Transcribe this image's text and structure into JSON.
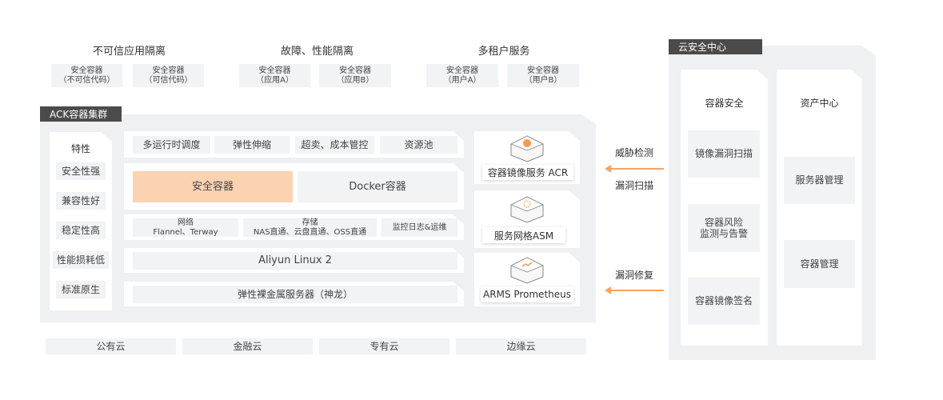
{
  "top_cards": [
    {
      "title": "不可信应用隔离",
      "items": [
        [
          "安全容器",
          "（不可信代码）"
        ],
        [
          "安全容器",
          "（可信代码）"
        ]
      ]
    },
    {
      "title": "故障、性能隔离",
      "items": [
        [
          "安全容器",
          "（应用A）"
        ],
        [
          "安全容器",
          "（应用B）"
        ]
      ]
    },
    {
      "title": "多租户服务",
      "items": [
        [
          "安全容器",
          "（用户A）"
        ],
        [
          "安全容器",
          "（用户B）"
        ]
      ]
    }
  ],
  "ack": {
    "label": "ACK容器集群",
    "features": {
      "title": "特性",
      "items": [
        "安全性强",
        "兼容性好",
        "稳定性高",
        "性能损耗低",
        "标准原生"
      ]
    },
    "row1": [
      "多运行时调度",
      "弹性伸缩",
      "超卖、成本管控",
      "资源池"
    ],
    "row2": {
      "secure": "安全容器",
      "docker": "Docker容器",
      "highlight_color": "#fbd3b1"
    },
    "row3": [
      [
        "网络",
        "Flannel、Terway"
      ],
      [
        "存储",
        "NAS直通、云盘直通、OSS直通"
      ],
      [
        "监控日志&运维"
      ]
    ],
    "os": "Aliyun Linux 2",
    "hardware": "弹性裸金属服务器（神龙）",
    "services": [
      {
        "name": "容器镜像服务 ACR",
        "icon": "registry-cube-icon"
      },
      {
        "name": "服务网格ASM",
        "icon": "mesh-cube-icon"
      },
      {
        "name": "ARMS Prometheus",
        "icon": "monitor-cube-icon"
      }
    ]
  },
  "arrows": {
    "top": [
      "威胁检测",
      "漏洞扫描"
    ],
    "bottom": [
      "漏洞修复"
    ],
    "color": "#f5a46a"
  },
  "clouds": [
    "公有云",
    "金融云",
    "专有云",
    "边缘云"
  ],
  "security_center": {
    "label": "云安全中心",
    "container_security": {
      "title": "容器安全",
      "items": [
        "镜像漏洞扫描",
        "容器风险\n监测与告警",
        "容器镜像签名"
      ]
    },
    "asset_center": {
      "title": "资产中心",
      "items": [
        "服务器管理",
        "容器管理"
      ]
    }
  }
}
